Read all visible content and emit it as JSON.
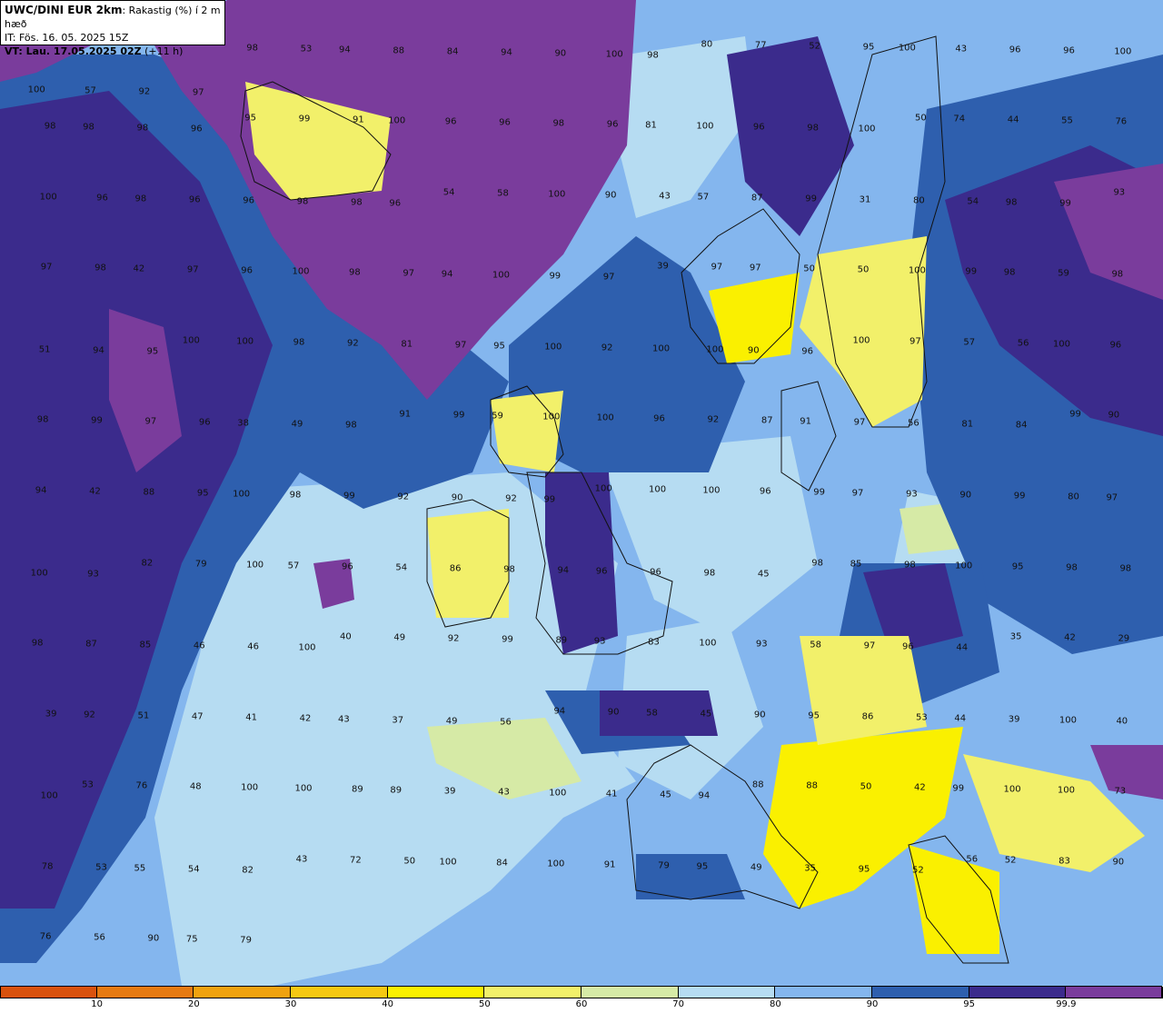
{
  "title": {
    "model": "UWC/DINI EUR 2km",
    "field": ": Rakastig (%) í 2 m hæð",
    "init_time": "IT: Fös. 16. 05. 2025 15Z",
    "valid_time": "VT: Lau. 17.05.2025 02Z",
    "lead": " (+11 h)"
  },
  "colorbar": {
    "bands": [
      {
        "from": 0,
        "to": 10,
        "color": "#d9520e"
      },
      {
        "from": 10,
        "to": 20,
        "color": "#e67a12"
      },
      {
        "from": 20,
        "to": 30,
        "color": "#f0a20f"
      },
      {
        "from": 30,
        "to": 40,
        "color": "#f6c812"
      },
      {
        "from": 40,
        "to": 50,
        "color": "#faf000"
      },
      {
        "from": 50,
        "to": 60,
        "color": "#f2f06a"
      },
      {
        "from": 60,
        "to": 70,
        "color": "#d6eaa6"
      },
      {
        "from": 70,
        "to": 80,
        "color": "#b6dcf2"
      },
      {
        "from": 80,
        "to": 90,
        "color": "#84b6ee"
      },
      {
        "from": 90,
        "to": 95,
        "color": "#2e5fae"
      },
      {
        "from": 95,
        "to": 99.9,
        "color": "#3b2b8c"
      },
      {
        "from": 99.9,
        "to": 100,
        "color": "#7a3c9c"
      }
    ],
    "tick_labels": [
      "10",
      "20",
      "30",
      "40",
      "50",
      "60",
      "70",
      "80",
      "90",
      "95",
      "99.9"
    ]
  },
  "map_labels": [
    "100",
    "57",
    "92",
    "97",
    "98",
    "53",
    "94",
    "88",
    "84",
    "94",
    "90",
    "100",
    "98",
    "80",
    "77",
    "52",
    "95",
    "100",
    "43",
    "96",
    "96",
    "100",
    "98",
    "98",
    "98",
    "96",
    "95",
    "99",
    "91",
    "100",
    "96",
    "96",
    "98",
    "96",
    "81",
    "100",
    "96",
    "98",
    "100",
    "50",
    "74",
    "44",
    "55",
    "76",
    "100",
    "96",
    "98",
    "96",
    "96",
    "98",
    "98",
    "96",
    "54",
    "58",
    "100",
    "90",
    "43",
    "57",
    "87",
    "99",
    "31",
    "80",
    "54",
    "98",
    "99",
    "93",
    "97",
    "98",
    "42",
    "97",
    "96",
    "100",
    "98",
    "97",
    "94",
    "100",
    "99",
    "97",
    "39",
    "97",
    "97",
    "50",
    "50",
    "100",
    "99",
    "98",
    "59",
    "98",
    "51",
    "94",
    "95",
    "100",
    "100",
    "98",
    "92",
    "81",
    "97",
    "95",
    "100",
    "92",
    "100",
    "100",
    "90",
    "96",
    "100",
    "97",
    "57",
    "56",
    "100",
    "96",
    "98",
    "99",
    "97",
    "96",
    "38",
    "49",
    "98",
    "91",
    "99",
    "59",
    "100",
    "100",
    "96",
    "92",
    "87",
    "91",
    "97",
    "56",
    "81",
    "84",
    "99",
    "90",
    "94",
    "42",
    "88",
    "95",
    "100",
    "98",
    "99",
    "92",
    "90",
    "92",
    "99",
    "100",
    "100",
    "100",
    "96",
    "99",
    "97",
    "93",
    "90",
    "99",
    "80",
    "97",
    "100",
    "93",
    "82",
    "79",
    "100",
    "57",
    "96",
    "54",
    "86",
    "98",
    "94",
    "96",
    "96",
    "98",
    "45",
    "98",
    "85",
    "98",
    "100",
    "95",
    "98",
    "98",
    "98",
    "87",
    "85",
    "46",
    "46",
    "100",
    "40",
    "49",
    "92",
    "99",
    "89",
    "93",
    "83",
    "100",
    "93",
    "58",
    "97",
    "96",
    "44",
    "35",
    "42",
    "29",
    "39",
    "92",
    "51",
    "47",
    "41",
    "42",
    "43",
    "37",
    "49",
    "56",
    "94",
    "90",
    "58",
    "45",
    "90",
    "95",
    "86",
    "53",
    "44",
    "39",
    "100",
    "40",
    "100",
    "53",
    "76",
    "48",
    "100",
    "100",
    "89",
    "89",
    "39",
    "43",
    "100",
    "41",
    "45",
    "94",
    "88",
    "88",
    "50",
    "42",
    "99",
    "100",
    "100",
    "73",
    "78",
    "53",
    "55",
    "54",
    "82",
    "43",
    "72",
    "50",
    "100",
    "84",
    "100",
    "91",
    "79",
    "95",
    "49",
    "35",
    "95",
    "52",
    "56",
    "52",
    "83",
    "90",
    "76",
    "56",
    "90",
    "75",
    "79"
  ]
}
